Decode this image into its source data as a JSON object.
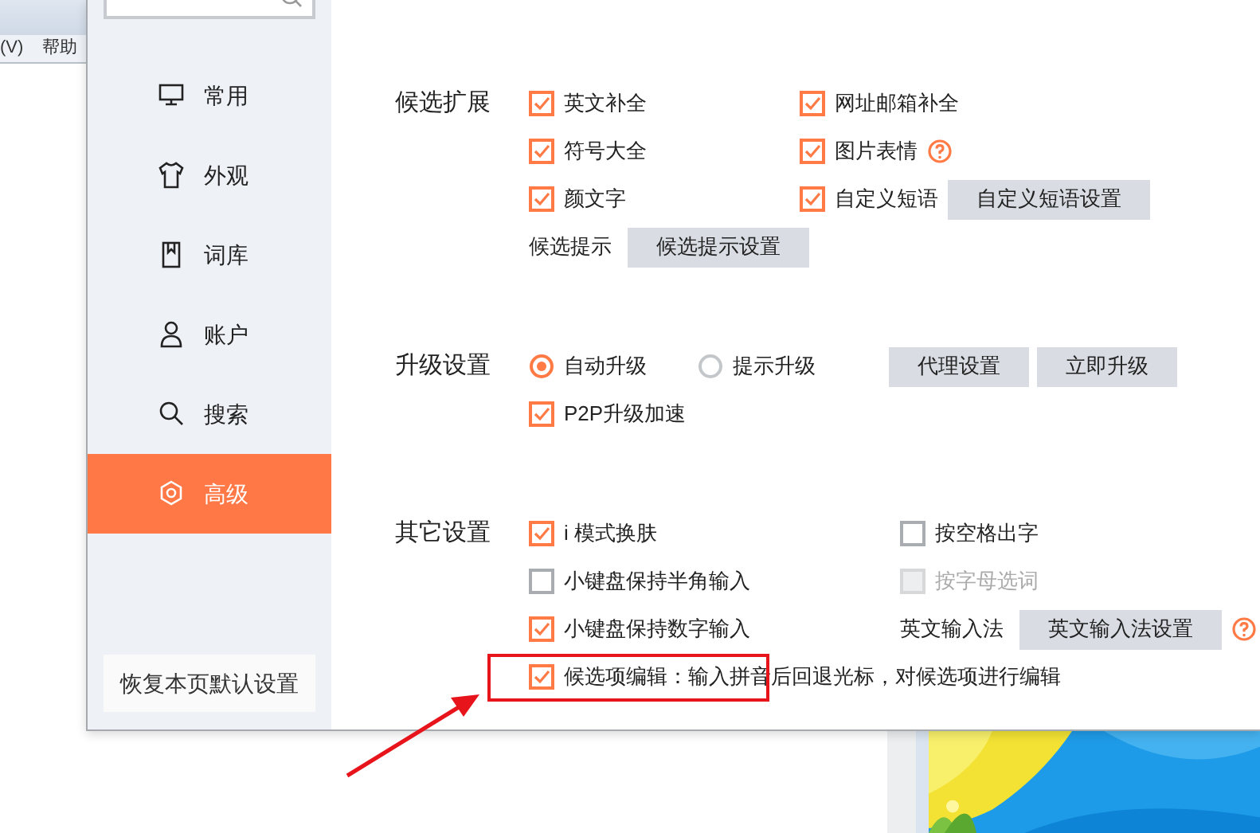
{
  "background_window": {
    "menu": [
      "(V)",
      "帮助"
    ]
  },
  "sidebar": {
    "items": [
      {
        "label": "常用",
        "selected": false
      },
      {
        "label": "外观",
        "selected": false
      },
      {
        "label": "词库",
        "selected": false
      },
      {
        "label": "账户",
        "selected": false
      },
      {
        "label": "搜索",
        "selected": false
      },
      {
        "label": "高级",
        "selected": true
      }
    ],
    "restore_button": "恢复本页默认设置"
  },
  "sections": [
    {
      "title": "候选扩展",
      "rows": [
        [
          [
            {
              "kind": "checkbox",
              "label": "英文补全",
              "checked": true,
              "disabled": false
            }
          ],
          [
            {
              "kind": "checkbox",
              "label": "网址邮箱补全",
              "checked": true,
              "disabled": false
            }
          ]
        ],
        [
          [
            {
              "kind": "checkbox",
              "label": "符号大全",
              "checked": true,
              "disabled": false
            }
          ],
          [
            {
              "kind": "checkbox",
              "label": "图片表情",
              "checked": true,
              "disabled": false
            },
            {
              "kind": "help"
            }
          ]
        ],
        [
          [
            {
              "kind": "checkbox",
              "label": "颜文字",
              "checked": true,
              "disabled": false
            }
          ],
          [
            {
              "kind": "checkbox",
              "label": "自定义短语",
              "checked": true,
              "disabled": false
            },
            {
              "kind": "button",
              "label": "自定义短语设置"
            }
          ]
        ],
        [
          [
            {
              "kind": "text",
              "label": "候选提示"
            },
            {
              "kind": "button",
              "label": "候选提示设置"
            }
          ]
        ]
      ]
    },
    {
      "title": "升级设置",
      "rows": [
        [
          [
            {
              "kind": "radio",
              "label": "自动升级",
              "selected": true
            }
          ],
          [
            {
              "kind": "radio",
              "label": "提示升级",
              "selected": false
            }
          ],
          [
            {
              "kind": "button",
              "label": "代理设置"
            },
            {
              "kind": "button",
              "label": "立即升级"
            }
          ]
        ],
        [
          [
            {
              "kind": "checkbox",
              "label": "P2P升级加速",
              "checked": true,
              "disabled": false
            }
          ]
        ]
      ]
    },
    {
      "title": "其它设置",
      "rows": [
        [
          [
            {
              "kind": "checkbox",
              "label": "i 模式换肤",
              "checked": true,
              "disabled": false
            }
          ],
          [
            {
              "kind": "checkbox",
              "label": "按空格出字",
              "checked": false,
              "disabled": false
            }
          ]
        ],
        [
          [
            {
              "kind": "checkbox",
              "label": "小键盘保持半角输入",
              "checked": false,
              "disabled": false
            }
          ],
          [
            {
              "kind": "checkbox",
              "label": "按字母选词",
              "checked": false,
              "disabled": true
            }
          ]
        ],
        [
          [
            {
              "kind": "checkbox",
              "label": "小键盘保持数字输入",
              "checked": true,
              "disabled": false
            }
          ],
          [
            {
              "kind": "text",
              "label": "英文输入法"
            },
            {
              "kind": "button",
              "label": "英文输入法设置"
            },
            {
              "kind": "help"
            }
          ]
        ],
        [
          [
            {
              "kind": "checkbox",
              "label": "候选项编辑：输入拼音后回退光标，对候选项进行编辑",
              "checked": true,
              "disabled": false
            }
          ]
        ]
      ]
    }
  ]
}
